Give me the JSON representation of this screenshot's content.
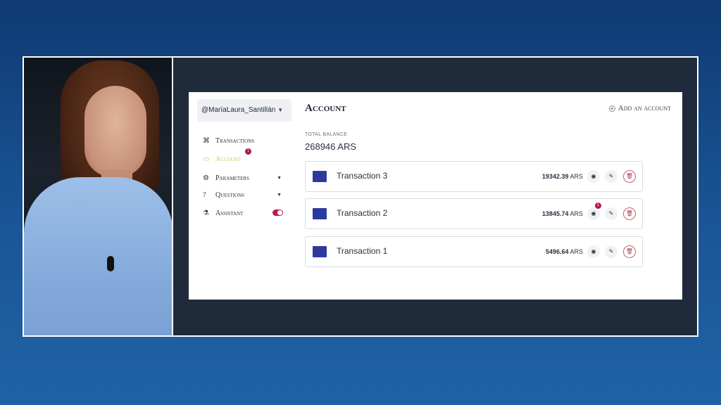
{
  "sidebar": {
    "username": "@MaríaLaura_Santillán",
    "items": [
      {
        "label": "Transactions",
        "icon": "grid-icon"
      },
      {
        "label": "Account",
        "icon": "card-icon",
        "badge": "1"
      },
      {
        "label": "Parameters",
        "icon": "gear-icon"
      },
      {
        "label": "Questions",
        "icon": "help-icon"
      },
      {
        "label": "Assistant",
        "icon": "flask-icon",
        "toggle_on": true
      }
    ]
  },
  "main": {
    "title": "Account",
    "add_account": "Add an account",
    "balance_label": "TOTAL BALANCE",
    "balance_value": "268946 ARS",
    "transactions": [
      {
        "name": "Transaction 3",
        "amount": "19342.39",
        "currency": "ARS"
      },
      {
        "name": "Transaction 2",
        "amount": "13845.74",
        "currency": "ARS",
        "badge": "1"
      },
      {
        "name": "Transaction 1",
        "amount": "5496.64",
        "currency": "ARS"
      }
    ]
  },
  "colors": {
    "accent": "#c2184d",
    "active_nav": "#d9c84a",
    "tx_square": "#2c3aa0"
  }
}
